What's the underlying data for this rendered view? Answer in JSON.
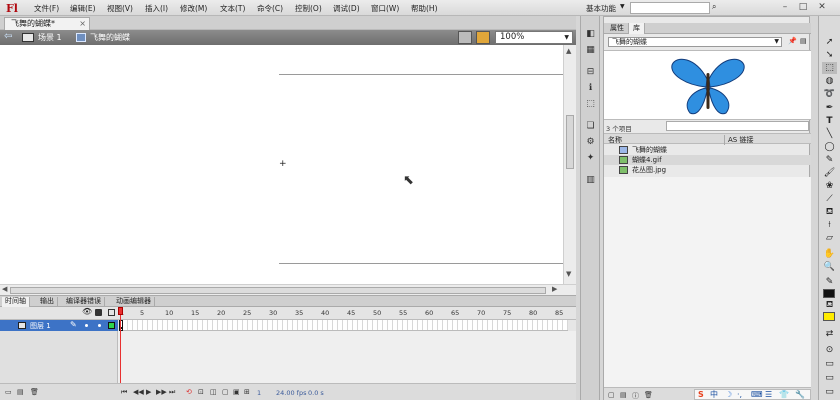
{
  "app": {
    "logo": "Fl"
  },
  "menu": [
    "文件(F)",
    "编辑(E)",
    "视图(V)",
    "插入(I)",
    "修改(M)",
    "文本(T)",
    "命令(C)",
    "控制(O)",
    "调试(D)",
    "窗口(W)",
    "帮助(H)"
  ],
  "workspace": {
    "label": "基本功能"
  },
  "window_controls": [
    "–",
    "□",
    "✕"
  ],
  "document_tab": {
    "title": "飞舞的蝴蝶*",
    "close": "×"
  },
  "edit_bar": {
    "scene": "场景 1",
    "symbol": "飞舞的蝴蝶",
    "zoom": "100%"
  },
  "timeline": {
    "tabs": [
      "时间轴",
      "输出",
      "编译器错误",
      "动画编辑器"
    ],
    "frame_numbers": [
      "1",
      "5",
      "10",
      "15",
      "20",
      "25",
      "30",
      "35",
      "40",
      "45",
      "50",
      "55",
      "60",
      "65",
      "70",
      "75",
      "80",
      "85"
    ],
    "layer_name": "图层 1",
    "status": {
      "frame": "1",
      "fps": "24.00 fps",
      "time": "0.0 s"
    }
  },
  "library": {
    "tabs": [
      "属性",
      "库"
    ],
    "document": "飞舞的蝴蝶",
    "count": "3 个项目",
    "columns": {
      "name": "名称",
      "linkage": "AS 链接"
    },
    "items": [
      {
        "label": "飞舞的蝴蝶",
        "type": "movieclip"
      },
      {
        "label": "蝴蝶4.gif",
        "type": "bitmap"
      },
      {
        "label": "花丛图.jpg",
        "type": "bitmap"
      }
    ],
    "preview_colors": {
      "wing": "#2f8fe0",
      "wing_dark": "#123b7a",
      "body": "#3b2a1a"
    }
  },
  "ime": {
    "items": [
      "S",
      "中",
      "☽",
      "·,",
      "⌨",
      "☰",
      "👕",
      "🔧"
    ]
  }
}
